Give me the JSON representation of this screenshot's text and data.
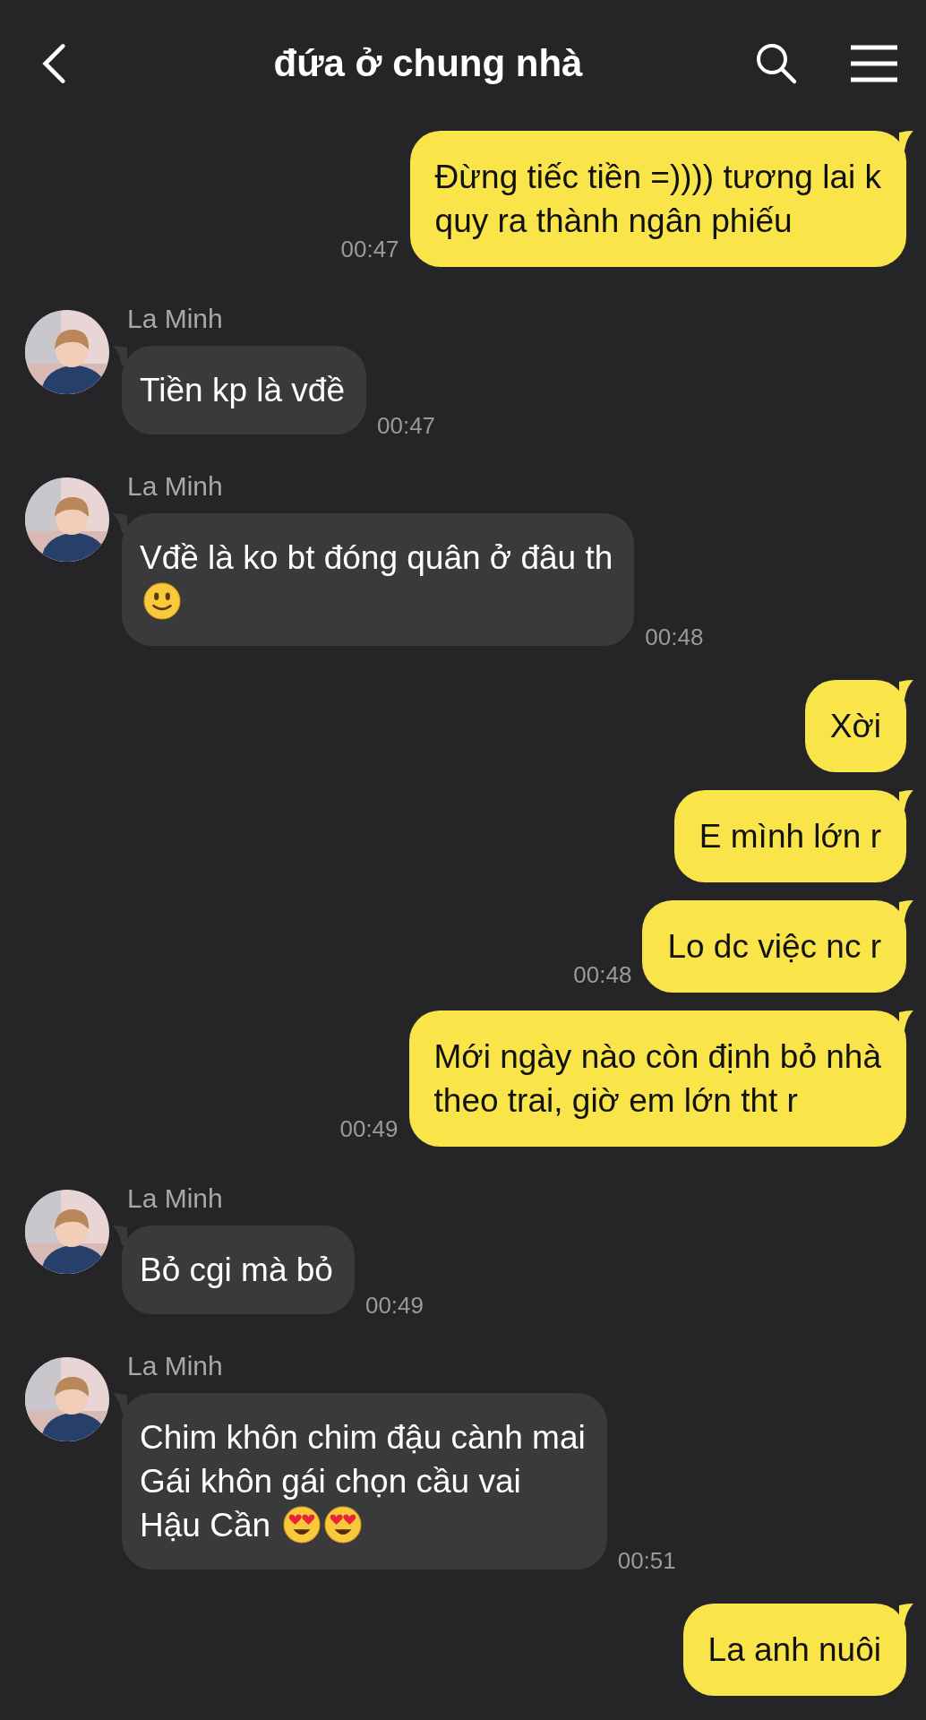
{
  "header": {
    "title": "đứa ở chung nhà"
  },
  "messages": [
    {
      "kind": "out",
      "text": "Đừng tiếc tiền =)))) tương lai k\nquy ra thành ngân phiếu",
      "time": "00:47"
    },
    {
      "kind": "in",
      "name": "La Minh",
      "text": "Tiền kp là vđề",
      "time": "00:47"
    },
    {
      "kind": "in",
      "name": "La Minh",
      "text": "Vđề là ko bt đóng quân ở đâu th\n",
      "emojis": [
        {
          "kind": "slight-smile"
        }
      ],
      "time": "00:48"
    },
    {
      "kind": "out",
      "text": "Xời"
    },
    {
      "kind": "out",
      "text": "E mình lớn r"
    },
    {
      "kind": "out",
      "text": "Lo dc việc nc r",
      "time": "00:48"
    },
    {
      "kind": "out",
      "text": "Mới ngày nào còn định bỏ nhà\ntheo trai, giờ em lớn tht r",
      "time": "00:49"
    },
    {
      "kind": "in",
      "name": "La Minh",
      "text": "Bỏ cgi mà bỏ",
      "time": "00:49"
    },
    {
      "kind": "in",
      "name": "La Minh",
      "text": "Chim khôn chim đậu cành mai\nGái khôn gái chọn cầu vai\nHậu Cần ",
      "emojis": [
        {
          "kind": "heart-eyes"
        },
        {
          "kind": "heart-eyes"
        }
      ],
      "time": "00:51"
    },
    {
      "kind": "out",
      "text": "La anh nuôi"
    }
  ]
}
